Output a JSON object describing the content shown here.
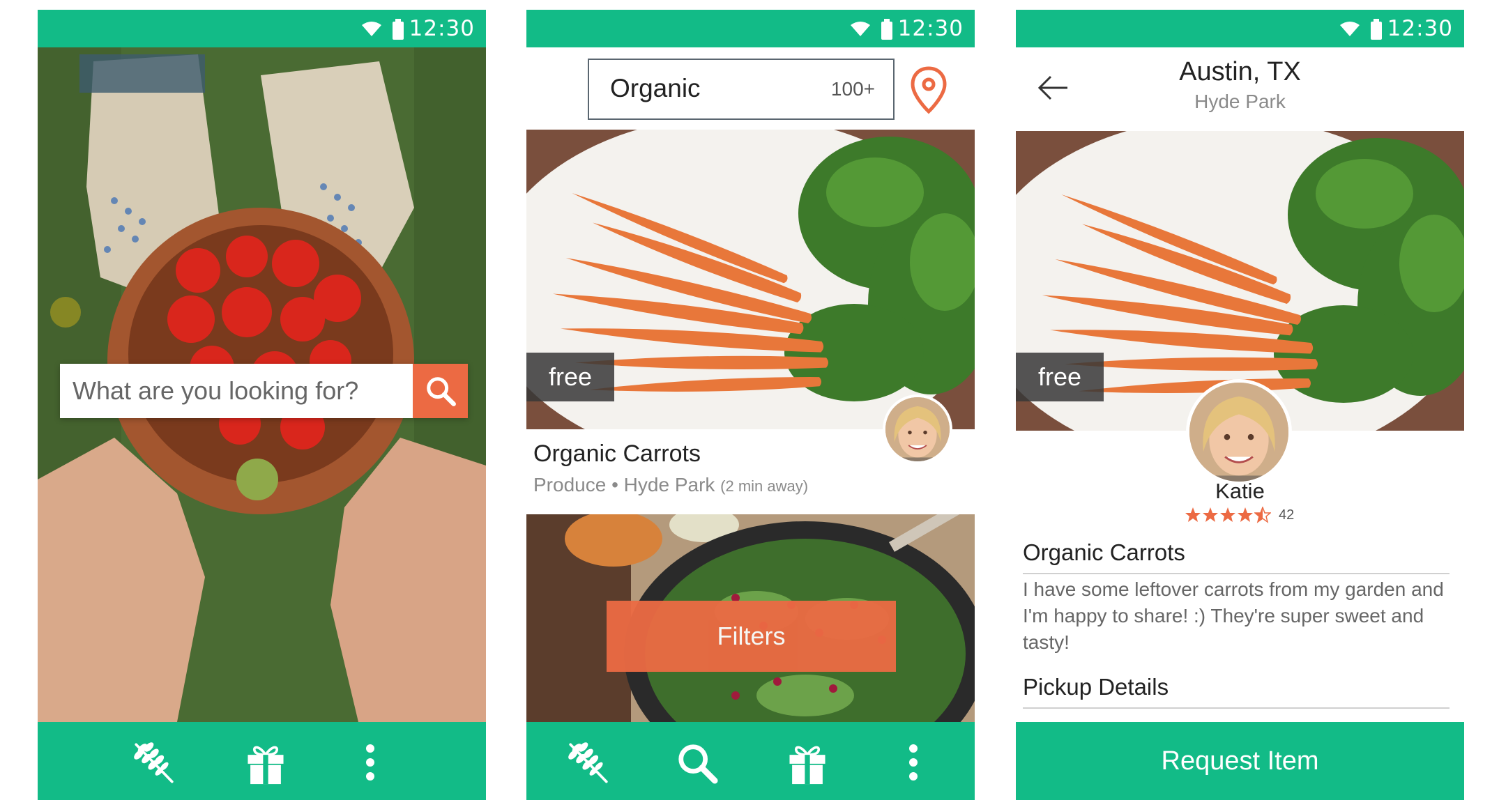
{
  "colors": {
    "brand_green": "#12bb87",
    "accent_orange": "#ec6a43",
    "overlay_dark": "#373737"
  },
  "status_bar": {
    "time": "12:30"
  },
  "screen_home": {
    "search_placeholder": "What are you looking for?",
    "nav_icons": [
      "wheat-icon",
      "gift-icon",
      "more-vert-icon"
    ]
  },
  "screen_results": {
    "search_term": "Organic",
    "result_count": "100+",
    "location_icon": "map-pin-icon",
    "listing": {
      "price": "free",
      "title": "Organic Carrots",
      "category": "Produce",
      "separator": "•",
      "neighborhood": "Hyde Park",
      "distance": "(2 min away)"
    },
    "filters_label": "Filters",
    "nav_icons": [
      "wheat-icon",
      "search-icon",
      "gift-icon",
      "more-vert-icon"
    ]
  },
  "screen_detail": {
    "city": "Austin, TX",
    "neighborhood": "Hyde Park",
    "price": "free",
    "owner_name": "Katie",
    "rating_stars": 4.5,
    "rating_count": "42",
    "title": "Organic Carrots",
    "description": "I have some leftover carrots from my garden and I'm happy to share! :) They're super sweet and tasty!",
    "pickup_heading": "Pickup Details",
    "request_label": "Request Item"
  }
}
